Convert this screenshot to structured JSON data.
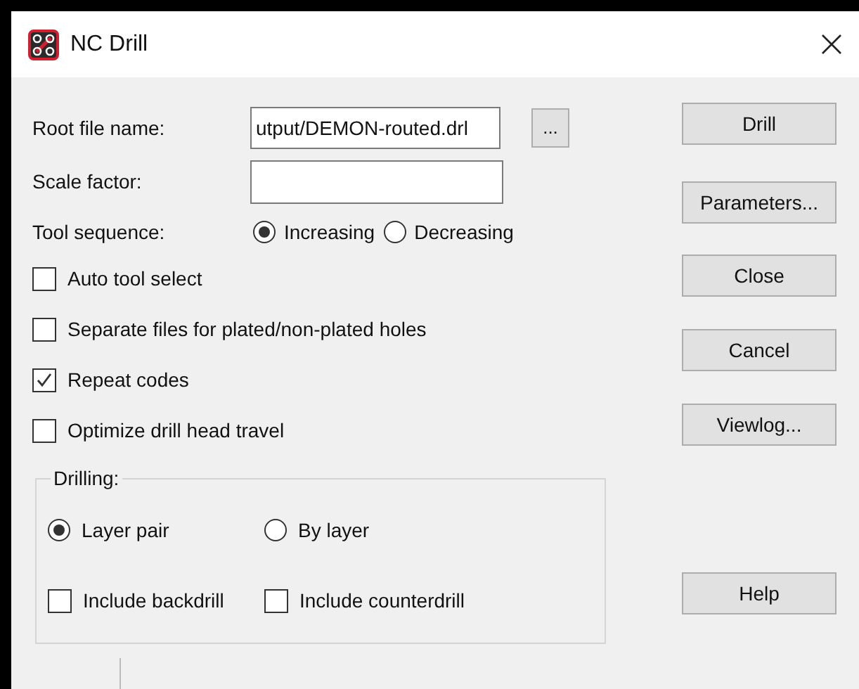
{
  "window": {
    "title": "NC Drill"
  },
  "root_file": {
    "label": "Root file name:",
    "value": "utput/DEMON-routed.drl",
    "browse": "..."
  },
  "scale_factor": {
    "label": "Scale factor:"
  },
  "tool_sequence": {
    "label": "Tool sequence:",
    "options": [
      {
        "label": "Increasing",
        "selected": true
      },
      {
        "label": "Decreasing",
        "selected": false
      }
    ]
  },
  "options": [
    {
      "label": "Auto tool select",
      "checked": false
    },
    {
      "label": "Separate files for plated/non-plated holes",
      "checked": false
    },
    {
      "label": "Repeat codes",
      "checked": true
    },
    {
      "label": "Optimize drill head travel",
      "checked": false
    }
  ],
  "drilling": {
    "title": "Drilling:",
    "modes": [
      {
        "label": "Layer pair",
        "selected": true
      },
      {
        "label": "By layer",
        "selected": false
      }
    ],
    "includes": [
      {
        "label": "Include backdrill",
        "checked": false
      },
      {
        "label": "Include counterdrill",
        "checked": false
      }
    ]
  },
  "buttons": [
    "Drill",
    "Parameters...",
    "Close",
    "Cancel",
    "Viewlog...",
    "Help"
  ]
}
